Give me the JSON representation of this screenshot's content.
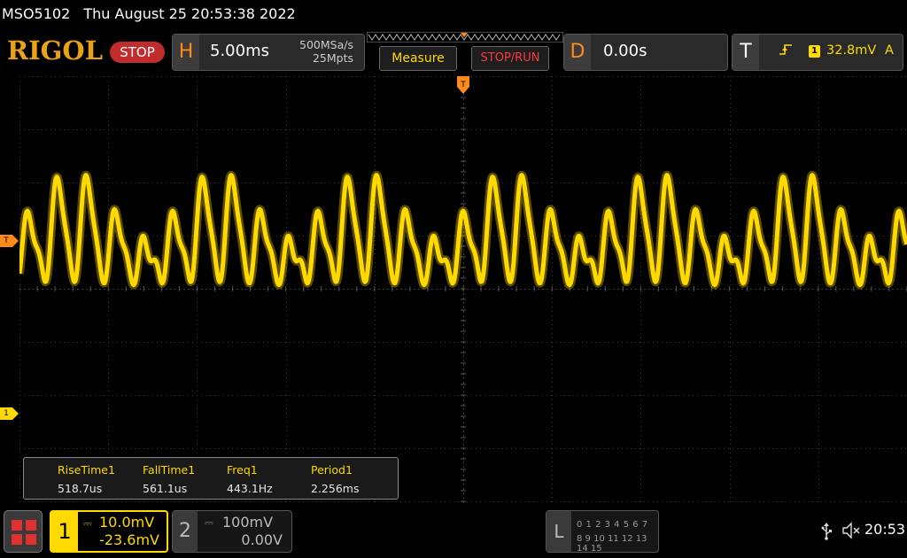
{
  "title_line": {
    "model": "MSO5102",
    "datetime": "Thu August 25 20:53:38 2022"
  },
  "brand": "RIGOL",
  "run_state": "STOP",
  "horizontal": {
    "letter": "H",
    "timebase": "5.00ms",
    "sample_rate": "500MSa/s",
    "memory_depth": "25Mpts"
  },
  "buttons": {
    "measure": "Measure",
    "stop_run": "STOP/RUN"
  },
  "delay": {
    "letter": "D",
    "value": "0.00s"
  },
  "trigger": {
    "letter": "T",
    "edge_icon": "rising-edge-icon",
    "source": "1",
    "level": "32.8mV",
    "mode": "A",
    "marker_label": "T"
  },
  "channel_marker_label": "1",
  "measurements": [
    {
      "name": "RiseTime1",
      "value": "518.7us"
    },
    {
      "name": "FallTime1",
      "value": "561.1us"
    },
    {
      "name": "Freq1",
      "value": "443.1Hz"
    },
    {
      "name": "Period1",
      "value": "2.256ms"
    }
  ],
  "ch1": {
    "number": "1",
    "coupling": "⎓",
    "scale": "10.0mV",
    "offset": "-23.6mV",
    "color": "#ffd900"
  },
  "ch2": {
    "number": "2",
    "coupling": "⎓",
    "scale": "100mV",
    "offset": "0.00V"
  },
  "la": {
    "letter": "L",
    "row1": "0 1 2 3  4 5 6 7",
    "row2": "8 9 10 11 12 13 14 15"
  },
  "status": {
    "clock": "20:53"
  },
  "waveform": {
    "frequency_hz": 443.1,
    "color": "#ffd900"
  }
}
